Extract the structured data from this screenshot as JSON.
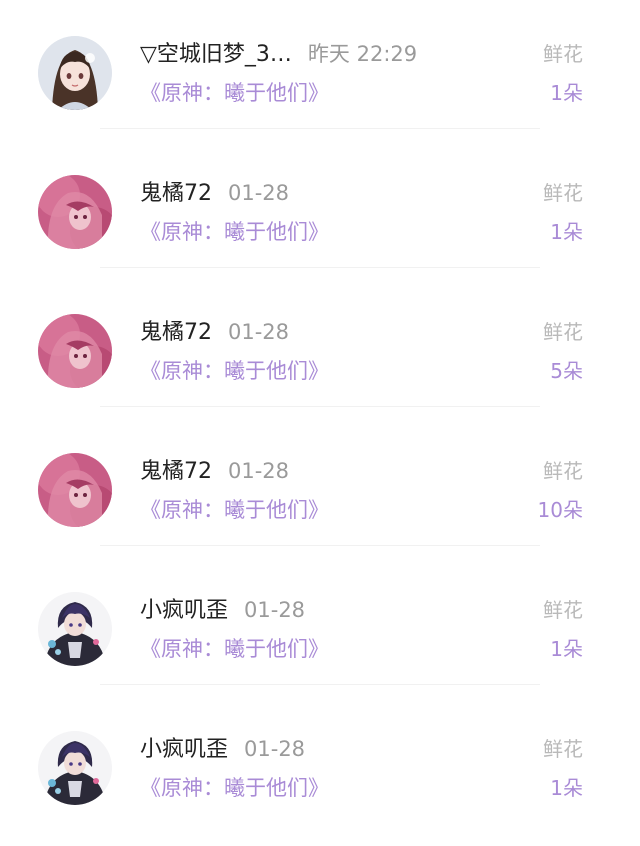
{
  "gift_records": [
    {
      "username": "▽空城旧梦_3…",
      "time": "昨天 22:29",
      "book": "《原神：曦于他们》",
      "gift_label": "鲜花",
      "gift_count": "1朵",
      "avatar": "anime-girl-brown-hair-avatar"
    },
    {
      "username": "鬼橘72",
      "time": "01-28",
      "book": "《原神：曦于他们》",
      "gift_label": "鲜花",
      "gift_count": "1朵",
      "avatar": "anime-pink-hair-avatar"
    },
    {
      "username": "鬼橘72",
      "time": "01-28",
      "book": "《原神：曦于他们》",
      "gift_label": "鲜花",
      "gift_count": "5朵",
      "avatar": "anime-pink-hair-avatar"
    },
    {
      "username": "鬼橘72",
      "time": "01-28",
      "book": "《原神：曦于他们》",
      "gift_label": "鲜花",
      "gift_count": "10朵",
      "avatar": "anime-pink-hair-avatar"
    },
    {
      "username": "小疯叽歪",
      "time": "01-28",
      "book": "《原神：曦于他们》",
      "gift_label": "鲜花",
      "gift_count": "1朵",
      "avatar": "anime-dark-hair-boy-avatar"
    },
    {
      "username": "小疯叽歪",
      "time": "01-28",
      "book": "《原神：曦于他们》",
      "gift_label": "鲜花",
      "gift_count": "1朵",
      "avatar": "anime-dark-hair-boy-avatar"
    }
  ],
  "colors": {
    "accent": "#a98bd6",
    "muted": "#9a9a9a",
    "label": "#b9b9b9",
    "text": "#222222"
  }
}
